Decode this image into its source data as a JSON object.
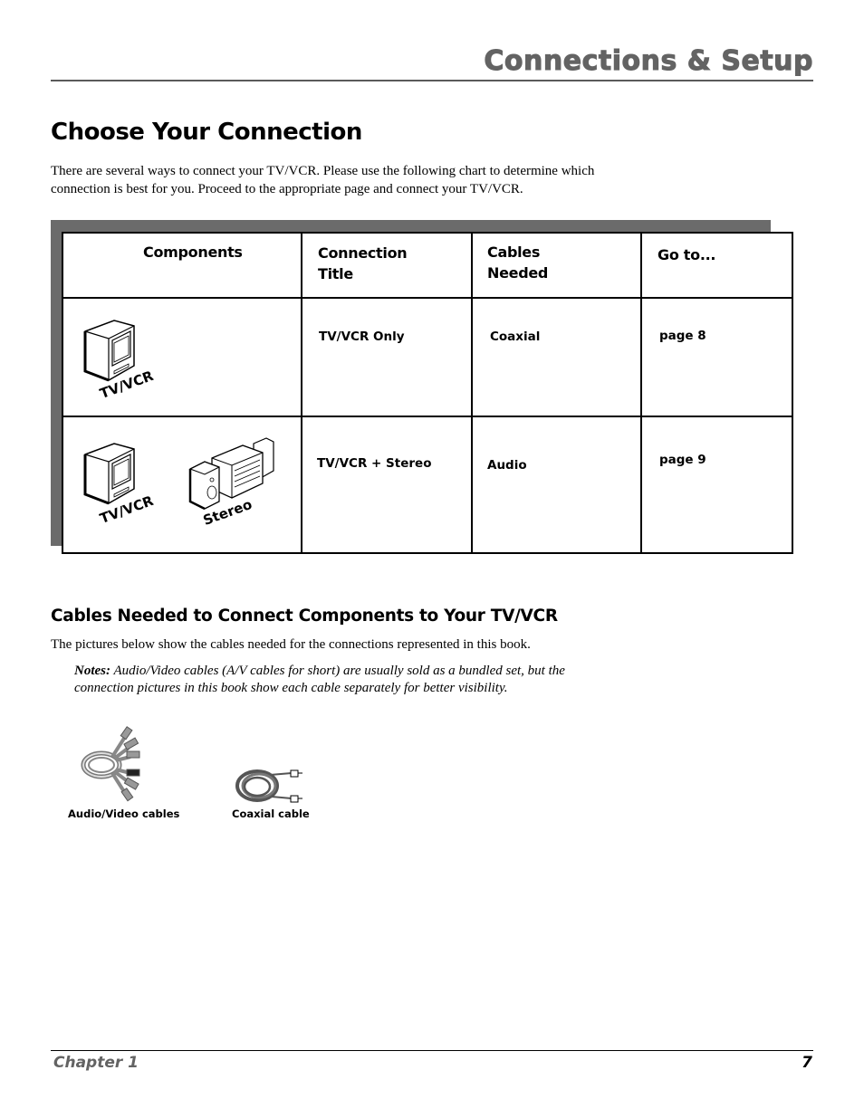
{
  "header": {
    "section_title": "Connections & Setup"
  },
  "page_title": "Choose Your Connection",
  "intro": "There are several ways to connect your TV/VCR. Please use the following chart to determine which connection is best for you. Proceed to the appropriate page and connect your TV/VCR.",
  "table": {
    "headers": {
      "components": "Components",
      "connection_title": "Connection Title",
      "cables_needed": "Cables Needed",
      "goto": "Go to..."
    },
    "rows": [
      {
        "component_icons": [
          "tv-vcr-icon"
        ],
        "component_labels": [
          "TV/VCR"
        ],
        "connection_title": "TV/VCR Only",
        "cables": "Coaxial",
        "goto": "page 8"
      },
      {
        "component_icons": [
          "tv-vcr-icon",
          "stereo-icon"
        ],
        "component_labels": [
          "TV/VCR",
          "Stereo"
        ],
        "connection_title": "TV/VCR + Stereo",
        "cables": "Audio",
        "goto": "page 9"
      }
    ]
  },
  "cables_section": {
    "heading": "Cables Needed to Connect Components to Your TV/VCR",
    "paragraph": "The pictures below show the cables needed for the connections represented in this book.",
    "notes_label": "Notes:",
    "notes_text": "Audio/Video cables (A/V cables for short) are usually sold as a bundled set, but the connection pictures in this book show each cable separately for better visibility.",
    "figures": [
      {
        "icon": "av-cables-icon",
        "caption": "Audio/Video cables"
      },
      {
        "icon": "coaxial-cable-icon",
        "caption": "Coaxial cable"
      }
    ]
  },
  "footer": {
    "chapter": "Chapter 1",
    "page_number": "7"
  }
}
